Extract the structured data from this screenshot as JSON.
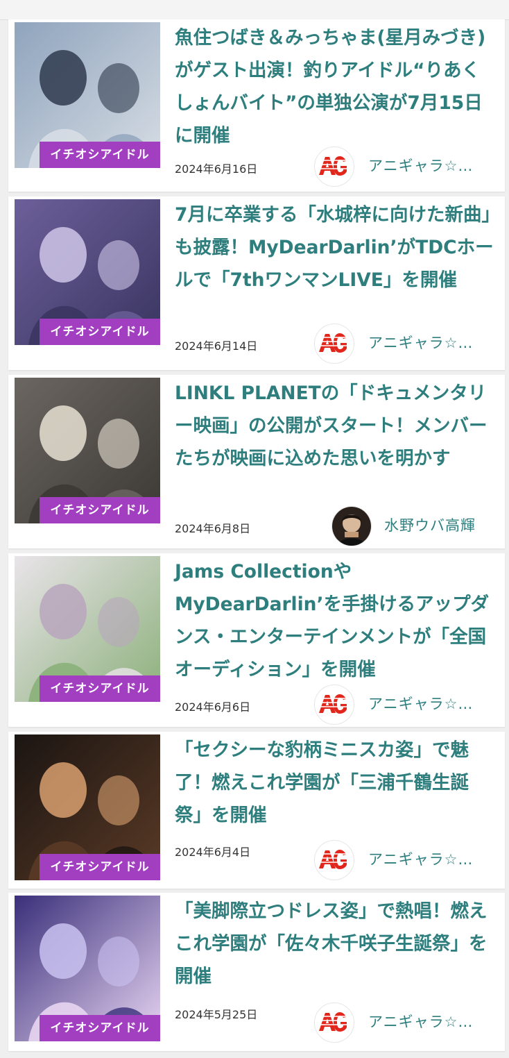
{
  "badge_label": "イチオシアイドル",
  "articles": [
    {
      "title": "魚住つばき＆みっちゃま(星月みづき)がゲスト出演！釣りアイドル“りあくしょんバイト”の単独公演が7月15日に開催",
      "date": "2024年6月16日",
      "author": "アニギャラ☆…",
      "author_avatar": "ag-logo",
      "thumb_colors": [
        "#8fa4bd",
        "#2f3a4d",
        "#d7dde4"
      ]
    },
    {
      "title": "7月に卒業する「水城梓に向けた新曲」も披露！MyDearDarlin’がTDCホールで「7thワンマンLIVE」を開催",
      "date": "2024年6月14日",
      "author": "アニギャラ☆…",
      "author_avatar": "ag-logo",
      "thumb_colors": [
        "#6c5f9a",
        "#cfc6e8",
        "#3a3560"
      ]
    },
    {
      "title": "LINKL PLANETの「ドキュメンタリー映画」の公開がスタート！メンバーたちが映画に込めた思いを明かす",
      "date": "2024年6月8日",
      "author": "水野ウバ高輝",
      "author_avatar": "person-photo",
      "thumb_colors": [
        "#6b6661",
        "#e6e0d2",
        "#3c3834"
      ]
    },
    {
      "title": "Jams CollectionやMyDearDarlin’を手掛けるアップダンス・エンターテインメントが「全国オーディション」を開催",
      "date": "2024年6月6日",
      "author": "アニギャラ☆…",
      "author_avatar": "ag-logo",
      "thumb_colors": [
        "#e9e4e9",
        "#b8a6bd",
        "#8bb07a"
      ]
    },
    {
      "title": "「セクシーな豹柄ミニスカ姿」で魅了！燃えこれ学園が「三浦千鶴生誕祭」を開催",
      "date": "2024年6月4日",
      "author": "アニギャラ☆…",
      "author_avatar": "ag-logo",
      "thumb_colors": [
        "#1b1512",
        "#d9a070",
        "#5a3a26"
      ]
    },
    {
      "title": "「美脚際立つドレス姿」で熱唱！燃えこれ学園が「佐々木千咲子生誕祭」を開催",
      "date": "2024年5月25日",
      "author": "アニギャラ☆…",
      "author_avatar": "ag-logo",
      "thumb_colors": [
        "#3a2f7a",
        "#c9c2f0",
        "#e8d5f2"
      ]
    }
  ]
}
